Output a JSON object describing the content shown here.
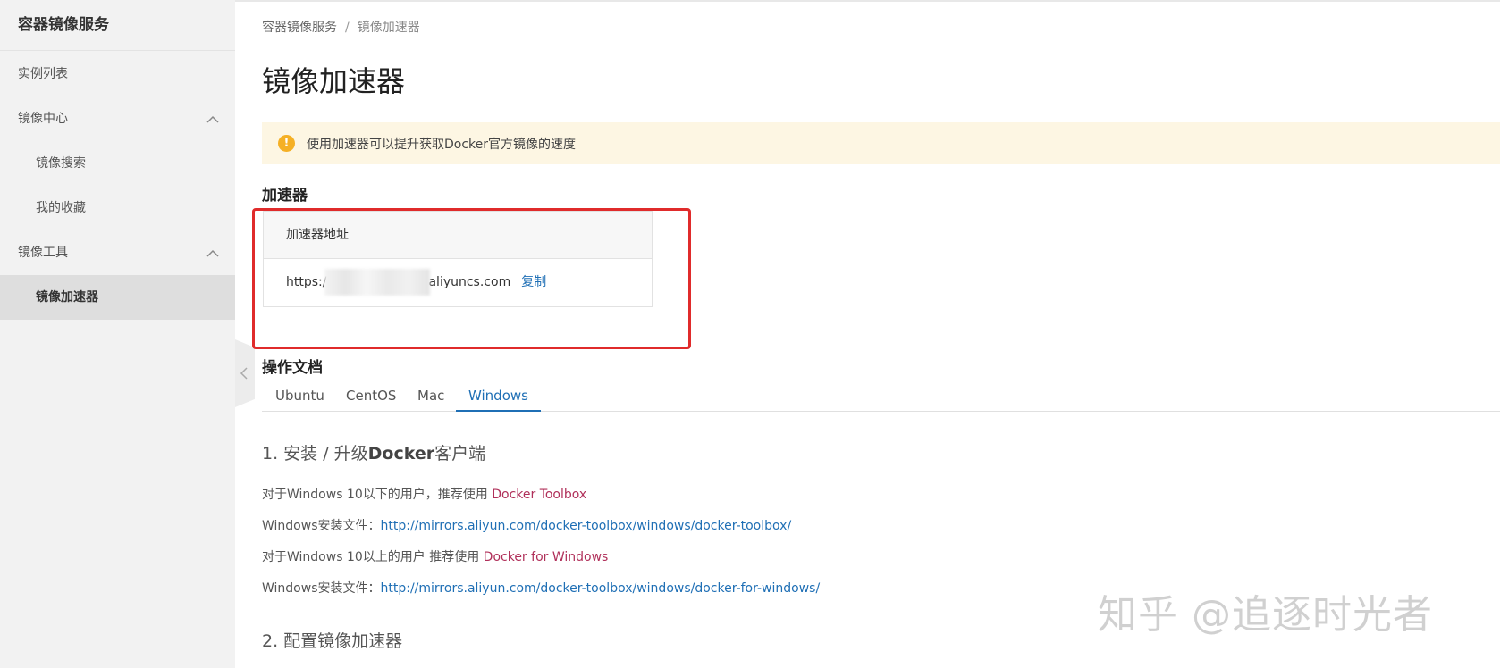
{
  "sidebar": {
    "title": "容器镜像服务",
    "items": [
      {
        "label": "实例列表"
      },
      {
        "label": "镜像中心"
      },
      {
        "label": "镜像搜索"
      },
      {
        "label": "我的收藏"
      },
      {
        "label": "镜像工具"
      },
      {
        "label": "镜像加速器"
      }
    ]
  },
  "breadcrumb": {
    "root": "容器镜像服务",
    "separator": "/",
    "current": "镜像加速器"
  },
  "page_title": "镜像加速器",
  "notice": {
    "icon": "!",
    "text": "使用加速器可以提升获取Docker官方镜像的速度",
    "color": "#fdf6e3"
  },
  "accelerator": {
    "heading": "加速器",
    "column": "加速器地址",
    "url_prefix": "https:/",
    "url_suffix": "aliyuncs.com",
    "copy_label": "复制"
  },
  "docs": {
    "heading": "操作文档",
    "tabs": [
      {
        "label": "Ubuntu"
      },
      {
        "label": "CentOS"
      },
      {
        "label": "Mac"
      },
      {
        "label": "Windows"
      }
    ],
    "step1": {
      "prefix": "1. 安装 / 升级",
      "bold": "Docker",
      "suffix": "客户端"
    },
    "lines": [
      {
        "text": "对于Windows 10以下的用户，推荐使用 ",
        "link": "Docker Toolbox"
      },
      {
        "text": "Windows安装文件：",
        "link": "http://mirrors.aliyun.com/docker-toolbox/windows/docker-toolbox/"
      },
      {
        "text": "对于Windows 10以上的用户 推荐使用 ",
        "link": "Docker for Windows"
      },
      {
        "text": "Windows安装文件：",
        "link": "http://mirrors.aliyun.com/docker-toolbox/windows/docker-for-windows/"
      }
    ],
    "step2": "2. 配置镜像加速器"
  },
  "watermark": "知乎 @追逐时光者",
  "colors": {
    "link_blue": "#1f6fb5",
    "link_red": "#b0305a",
    "highlight_red": "#e02b2b",
    "sidebar_bg": "#f2f2f2"
  }
}
